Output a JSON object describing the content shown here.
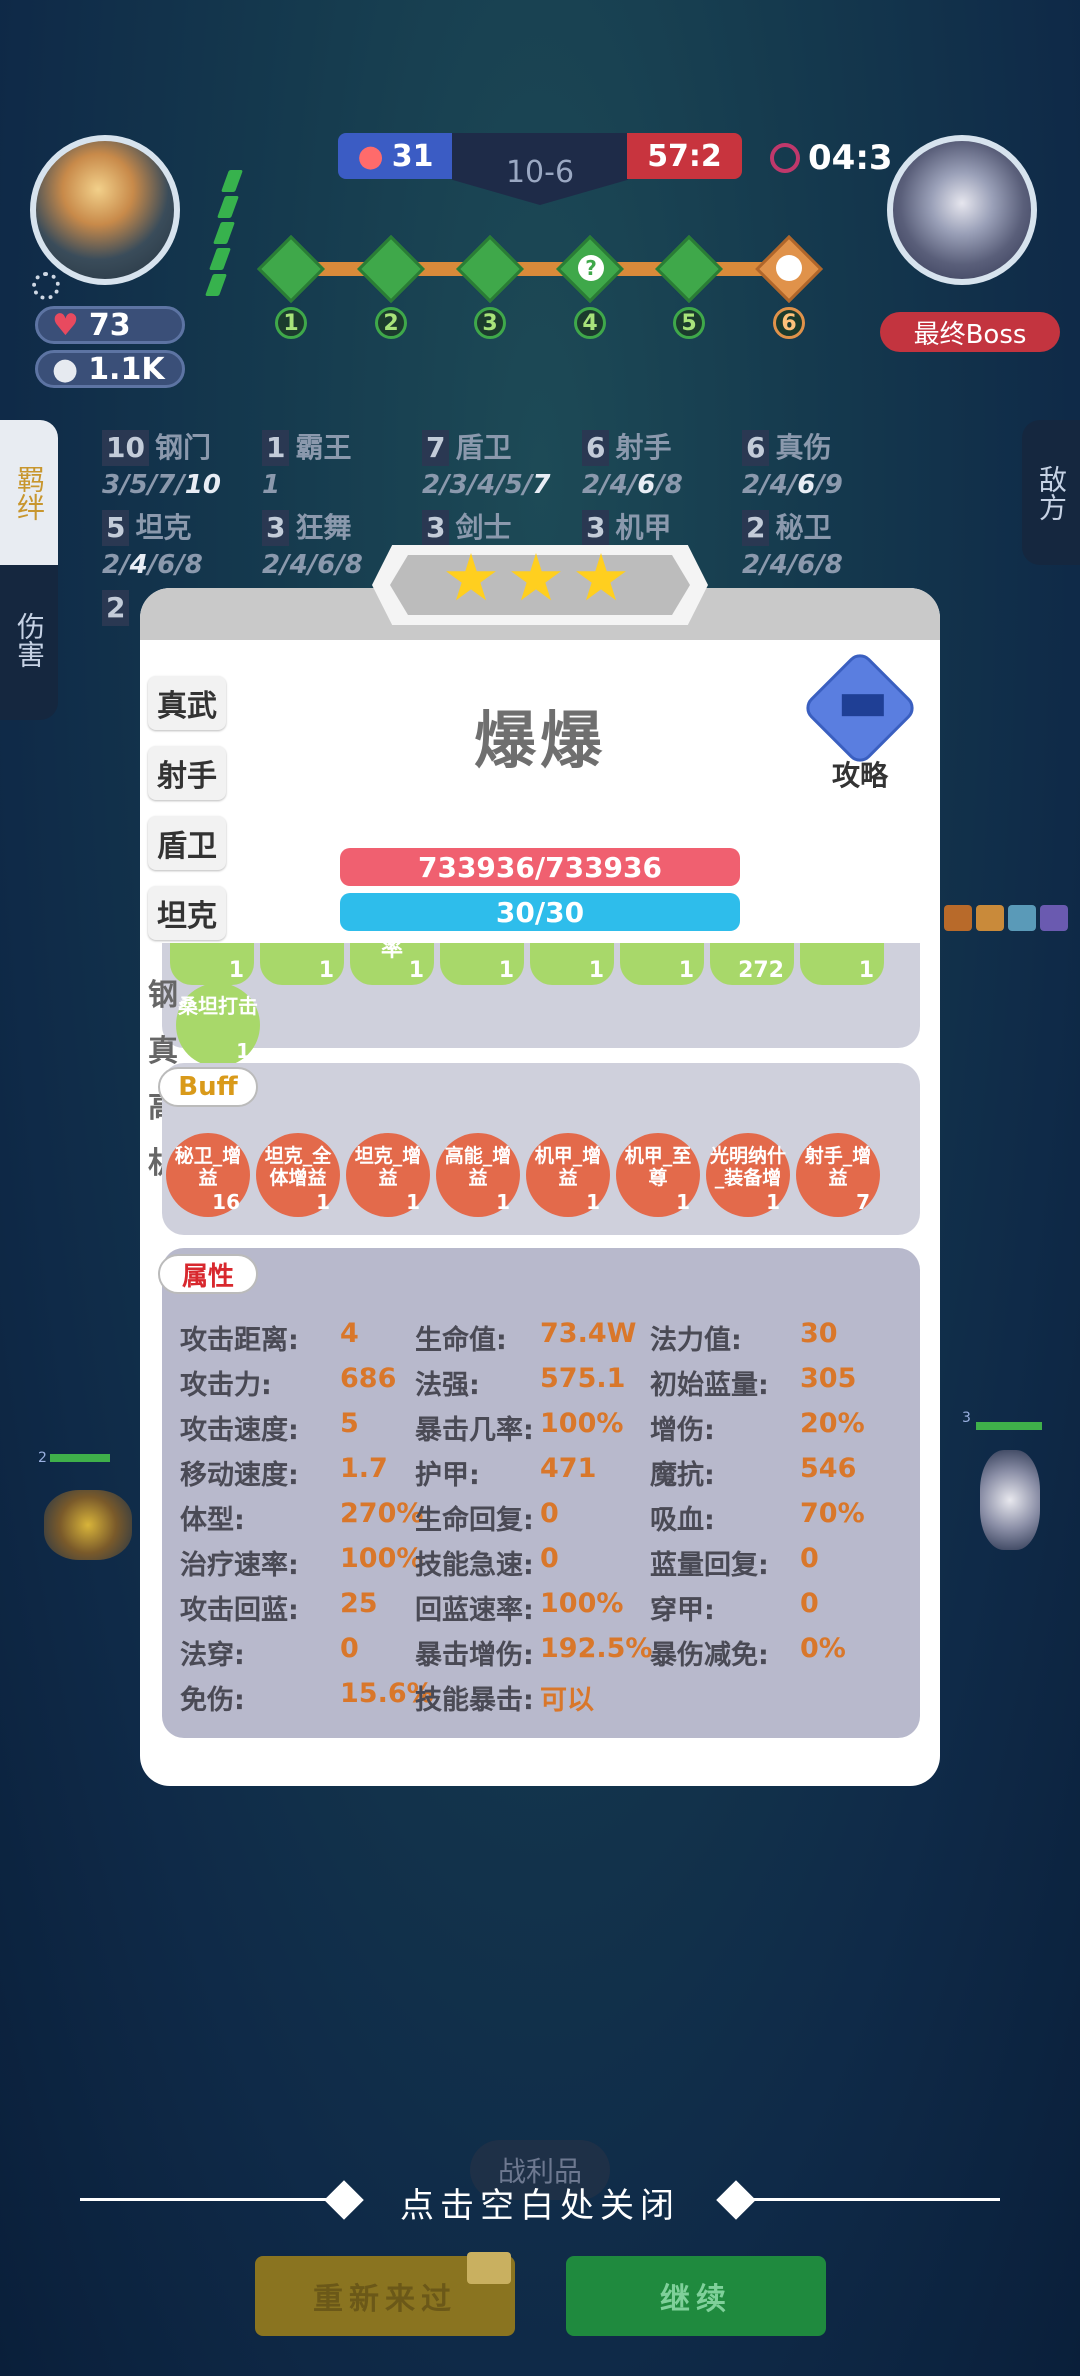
{
  "hud": {
    "player_hp": "73",
    "player_gold": "1.1K",
    "score_left": "31",
    "round": "10-6",
    "score_right": "57:2",
    "timer": "04:3",
    "stages": [
      "1",
      "2",
      "3",
      "4",
      "5",
      "6"
    ],
    "boss_label": "最终Boss"
  },
  "side_tabs": {
    "left_active": "羁绊",
    "left_inactive": "伤害",
    "right": "敌方"
  },
  "synergies": [
    {
      "count": "10",
      "name": "钢门",
      "levels_pre": "3/5/7/",
      "levels_active": "10",
      "levels_post": ""
    },
    {
      "count": "1",
      "name": "霸王",
      "levels_pre": "",
      "levels_active": "",
      "levels_post": "1"
    },
    {
      "count": "7",
      "name": "盾卫",
      "levels_pre": "2/3/4/5/",
      "levels_active": "7",
      "levels_post": ""
    },
    {
      "count": "6",
      "name": "射手",
      "levels_pre": "2/4/",
      "levels_active": "6",
      "levels_post": "/8"
    },
    {
      "count": "6",
      "name": "真伤",
      "levels_pre": "2/4/",
      "levels_active": "6",
      "levels_post": "/9"
    },
    {
      "count": "5",
      "name": "坦克",
      "levels_pre": "2/",
      "levels_active": "4",
      "levels_post": "/6/8"
    },
    {
      "count": "3",
      "name": "狂舞",
      "levels_pre": "2/4/6/8",
      "levels_active": "",
      "levels_post": ""
    },
    {
      "count": "3",
      "name": "剑士",
      "levels_pre": "",
      "levels_active": "",
      "levels_post": ""
    },
    {
      "count": "3",
      "name": "机甲",
      "levels_pre": "",
      "levels_active": "",
      "levels_post": ""
    },
    {
      "count": "2",
      "name": "秘卫",
      "levels_pre": "2/4/6/8",
      "levels_active": "",
      "levels_post": ""
    },
    {
      "count": "2",
      "name": "",
      "levels_pre": "",
      "levels_active": "",
      "levels_post": ""
    }
  ],
  "modal": {
    "star_count": 3,
    "hero_name": "爆爆",
    "guide_label": "攻略",
    "hp": "733936/733936",
    "mp": "30/30",
    "tabs": [
      "真武",
      "射手",
      "盾卫",
      "坦克"
    ],
    "hidden_tabs": [
      "钢",
      "真",
      "高",
      "机"
    ],
    "skills_partial": [
      {
        "label": "",
        "count": "1"
      },
      {
        "label": "",
        "count": "1"
      },
      {
        "label": "率",
        "count": "1"
      },
      {
        "label": "",
        "count": "1"
      },
      {
        "label": "",
        "count": "1"
      },
      {
        "label": "",
        "count": "1"
      },
      {
        "label": "",
        "count": "272"
      },
      {
        "label": "",
        "count": "1"
      }
    ],
    "skill_extra": {
      "label": "桑坦打击",
      "count": "1"
    },
    "buff_title": "Buff",
    "buffs": [
      {
        "label": "秘卫_增益",
        "count": "16"
      },
      {
        "label": "坦克_全体增益",
        "count": "1"
      },
      {
        "label": "坦克_增益",
        "count": "1"
      },
      {
        "label": "高能_增益",
        "count": "1"
      },
      {
        "label": "机甲_增益",
        "count": "1"
      },
      {
        "label": "机甲_至尊",
        "count": "1"
      },
      {
        "label": "光明纳什_装备增",
        "count": "1"
      },
      {
        "label": "射手_增益",
        "count": "7"
      }
    ],
    "attr_title": "属性",
    "attributes": [
      [
        {
          "k": "攻击距离:",
          "v": "4"
        },
        {
          "k": "生命值:",
          "v": "73.4W"
        },
        {
          "k": "法力值:",
          "v": "30"
        }
      ],
      [
        {
          "k": "攻击力:",
          "v": "686"
        },
        {
          "k": "法强:",
          "v": "575.1"
        },
        {
          "k": "初始蓝量:",
          "v": "305"
        }
      ],
      [
        {
          "k": "攻击速度:",
          "v": "5"
        },
        {
          "k": "暴击几率:",
          "v": "100%"
        },
        {
          "k": "增伤:",
          "v": "20%"
        }
      ],
      [
        {
          "k": "移动速度:",
          "v": "1.7"
        },
        {
          "k": "护甲:",
          "v": "471"
        },
        {
          "k": "魔抗:",
          "v": "546"
        }
      ],
      [
        {
          "k": "体型:",
          "v": "270%"
        },
        {
          "k": "生命回复:",
          "v": "0"
        },
        {
          "k": "吸血:",
          "v": "70%"
        }
      ],
      [
        {
          "k": "治疗速率:",
          "v": "100%"
        },
        {
          "k": "技能急速:",
          "v": "0"
        },
        {
          "k": "蓝量回复:",
          "v": "0"
        }
      ],
      [
        {
          "k": "攻击回蓝:",
          "v": "25"
        },
        {
          "k": "回蓝速率:",
          "v": "100%"
        },
        {
          "k": "穿甲:",
          "v": "0"
        }
      ],
      [
        {
          "k": "法穿:",
          "v": "0"
        },
        {
          "k": "暴击增伤:",
          "v": "192.5%"
        },
        {
          "k": "暴伤减免:",
          "v": "0%"
        }
      ],
      [
        {
          "k": "免伤:",
          "v": "15.6%"
        },
        {
          "k": "技能暴击:",
          "v": "可以"
        }
      ]
    ]
  },
  "footer": {
    "close_hint": "点击空白处关闭",
    "loot_label": "战利品",
    "retry_label": "重新来过",
    "continue_label": "继续"
  },
  "units": {
    "left_level": "2",
    "right_level": "3"
  },
  "colors": {
    "accent_green": "#3fa84a",
    "hp_bar": "#f06070",
    "mp_bar": "#2ebdeb",
    "buff_chip": "#e36a4b",
    "attr_value": "#d9772a"
  }
}
